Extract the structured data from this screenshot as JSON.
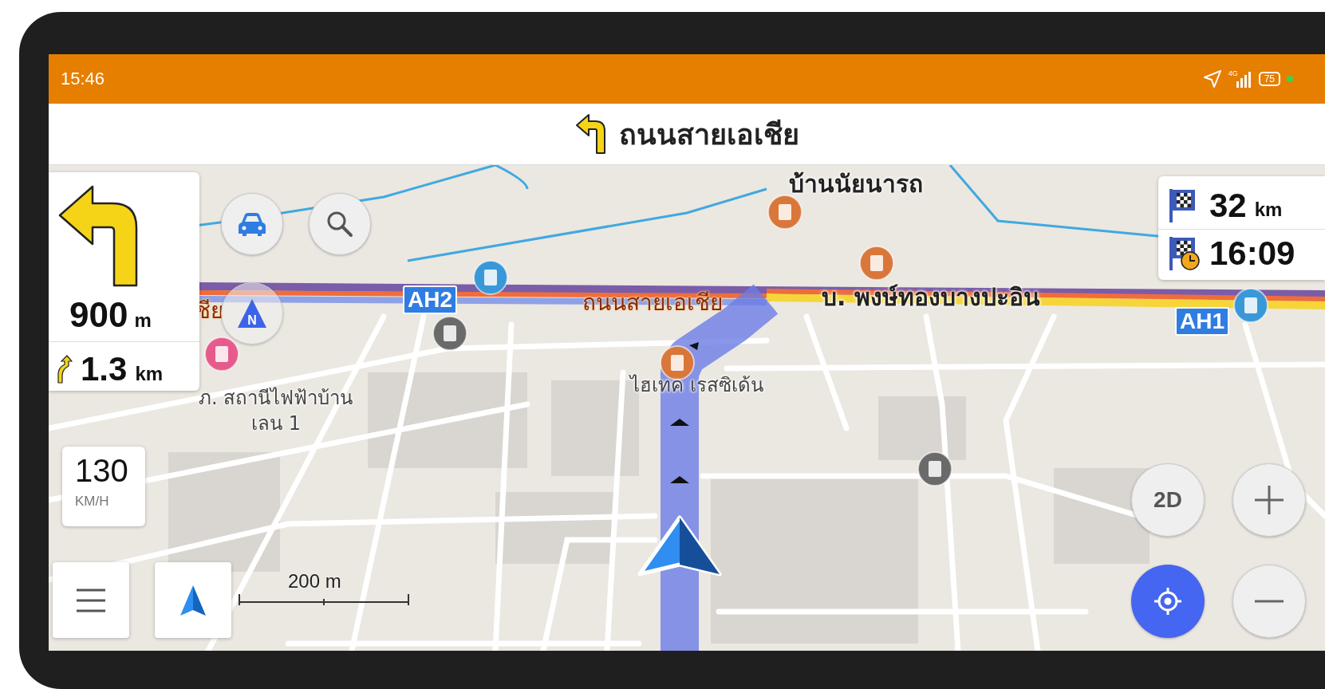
{
  "status_bar": {
    "time": "15:46",
    "network": "4G",
    "battery": "75"
  },
  "next_street": "ถนนสายเอเชีย",
  "turn_panel": {
    "distance": "900",
    "distance_unit": "m",
    "then_distance": "1.3",
    "then_unit": "km"
  },
  "compass": "N",
  "speed": {
    "value": "130",
    "unit": "KM/H"
  },
  "destination": {
    "distance": "32",
    "distance_unit": "km",
    "arrival": "16:09"
  },
  "map_labels": [
    {
      "text": "บ้านนัยนารถ",
      "kind": "place"
    },
    {
      "text": "ชีย",
      "kind": "road"
    },
    {
      "text": "AH2",
      "kind": "shield"
    },
    {
      "text": "ถนนสายเอเชีย",
      "kind": "road"
    },
    {
      "text": "บ. พงษ์ทองบางปะอิน",
      "kind": "place"
    },
    {
      "text": "AH1",
      "kind": "shield"
    },
    {
      "text": "ไฮเทค เรสซิเด้น",
      "kind": "poi"
    },
    {
      "text": "ภ. สถานีไฟฟ้าบ้าน",
      "kind": "poi"
    },
    {
      "text": "เลน 1",
      "kind": "poi"
    }
  ],
  "scale": "200 m",
  "view_mode": "2D"
}
